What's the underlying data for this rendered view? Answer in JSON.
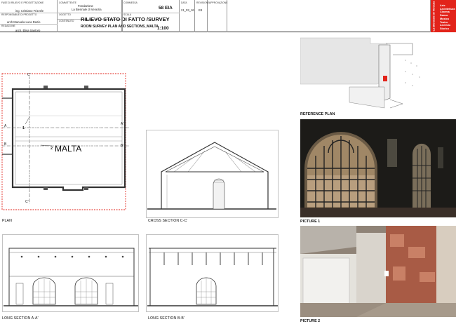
{
  "title_block": {
    "col1_label1": "FASE DI RILIEVO E PROGETTAZIONE",
    "col1_value1": "ing. Cristiano Frizzele",
    "col1_label2": "RESPONSABILE DI PROGETTO",
    "col1_value2": "arch Manuela Luca Dazio",
    "col1_label3": "REDAZIONE",
    "col1_value3": "arch. Elisa Santoro",
    "col2_label1": "COMMITTENTE",
    "col2_value1a": "Fondazione",
    "col2_value1b": "La Biennale di Venezia",
    "col2_label2": "OGGETTO",
    "title_main": "RILIEVO STATO DI FATTO /SURVEY",
    "col2_label3": "CONTENUTO",
    "title_sub": "ROOM SURVEY PLAN AND SECTIONS_MALTA",
    "col3_label1": "COMMESSA",
    "code": "58 EIA",
    "col3_label2": "SCALA",
    "scale": "1:100",
    "col4_label": "DATA",
    "date": "21_03_16",
    "col5_label": "REVISIONE",
    "revision": "E8",
    "col6_label": "APPROVAZIONE"
  },
  "logo": {
    "vertical_text": "La Biennale di Venezia",
    "lines": [
      "Arte",
      "Architettura",
      "Cinema",
      "Danza",
      "Musica",
      "Teatro",
      "Archivio Storico"
    ],
    "color": "#e2231a"
  },
  "plan": {
    "room_label": "MALTA",
    "markers": {
      "c_top": "C'",
      "c_bottom": "C'",
      "a_left": "A",
      "a_right": "A'",
      "b_left": "B",
      "b_right": "B'",
      "n1": "1",
      "n2": "2"
    },
    "caption": "PLAN",
    "boundary_color": "#e2231a"
  },
  "captions": {
    "cross_section": "CROSS SECTION C-C'",
    "long_a": "LONG SECTION A-A'",
    "long_b": "LONG SECTION B-B'",
    "reference_plan": "REFERENCE PLAN",
    "picture1": "PICTURE 1",
    "picture2": "PICTURE 2"
  }
}
